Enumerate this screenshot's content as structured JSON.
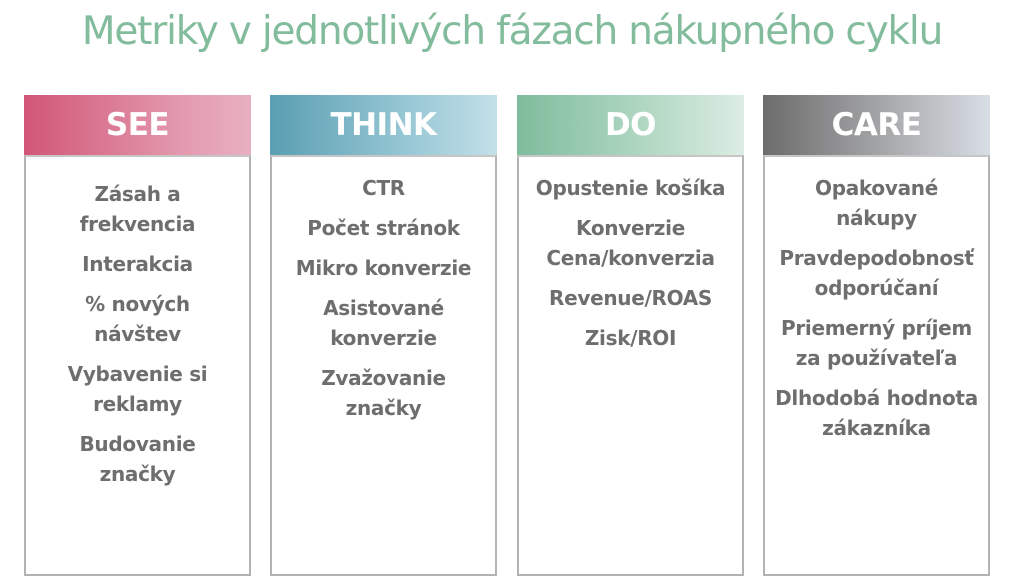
{
  "title": "Metriky v jednotlivých fázach nákupného cyklu",
  "colors": {
    "title": "#82bc9c",
    "item_text": "#6e6e6e",
    "see": "#d15676",
    "think": "#5a9fb2",
    "do": "#7fbc9c",
    "care": "#6c6c6c"
  },
  "columns": [
    {
      "header": "SEE",
      "items": [
        "Zásah a\nfrekvencia",
        "Interakcia",
        "% nových\nnávštev",
        "Vybavenie si\nreklamy",
        "Budovanie\nznačky"
      ]
    },
    {
      "header": "THINK",
      "items": [
        "CTR",
        "Počet stránok",
        "Mikro konverzie",
        "Asistované\nkonverzie",
        "Zvažovanie\nznačky"
      ]
    },
    {
      "header": "DO",
      "items": [
        "Opustenie košíka",
        "Konverzie\nCena/konverzia",
        "Revenue/ROAS",
        "Zisk/ROI"
      ]
    },
    {
      "header": "CARE",
      "items": [
        "Opakované\nnákupy",
        "Pravdepodobnosť\nodporúčaní",
        "Priemerný príjem\nza používateľa",
        "Dlhodobá hodnota\nzákazníka"
      ]
    }
  ]
}
